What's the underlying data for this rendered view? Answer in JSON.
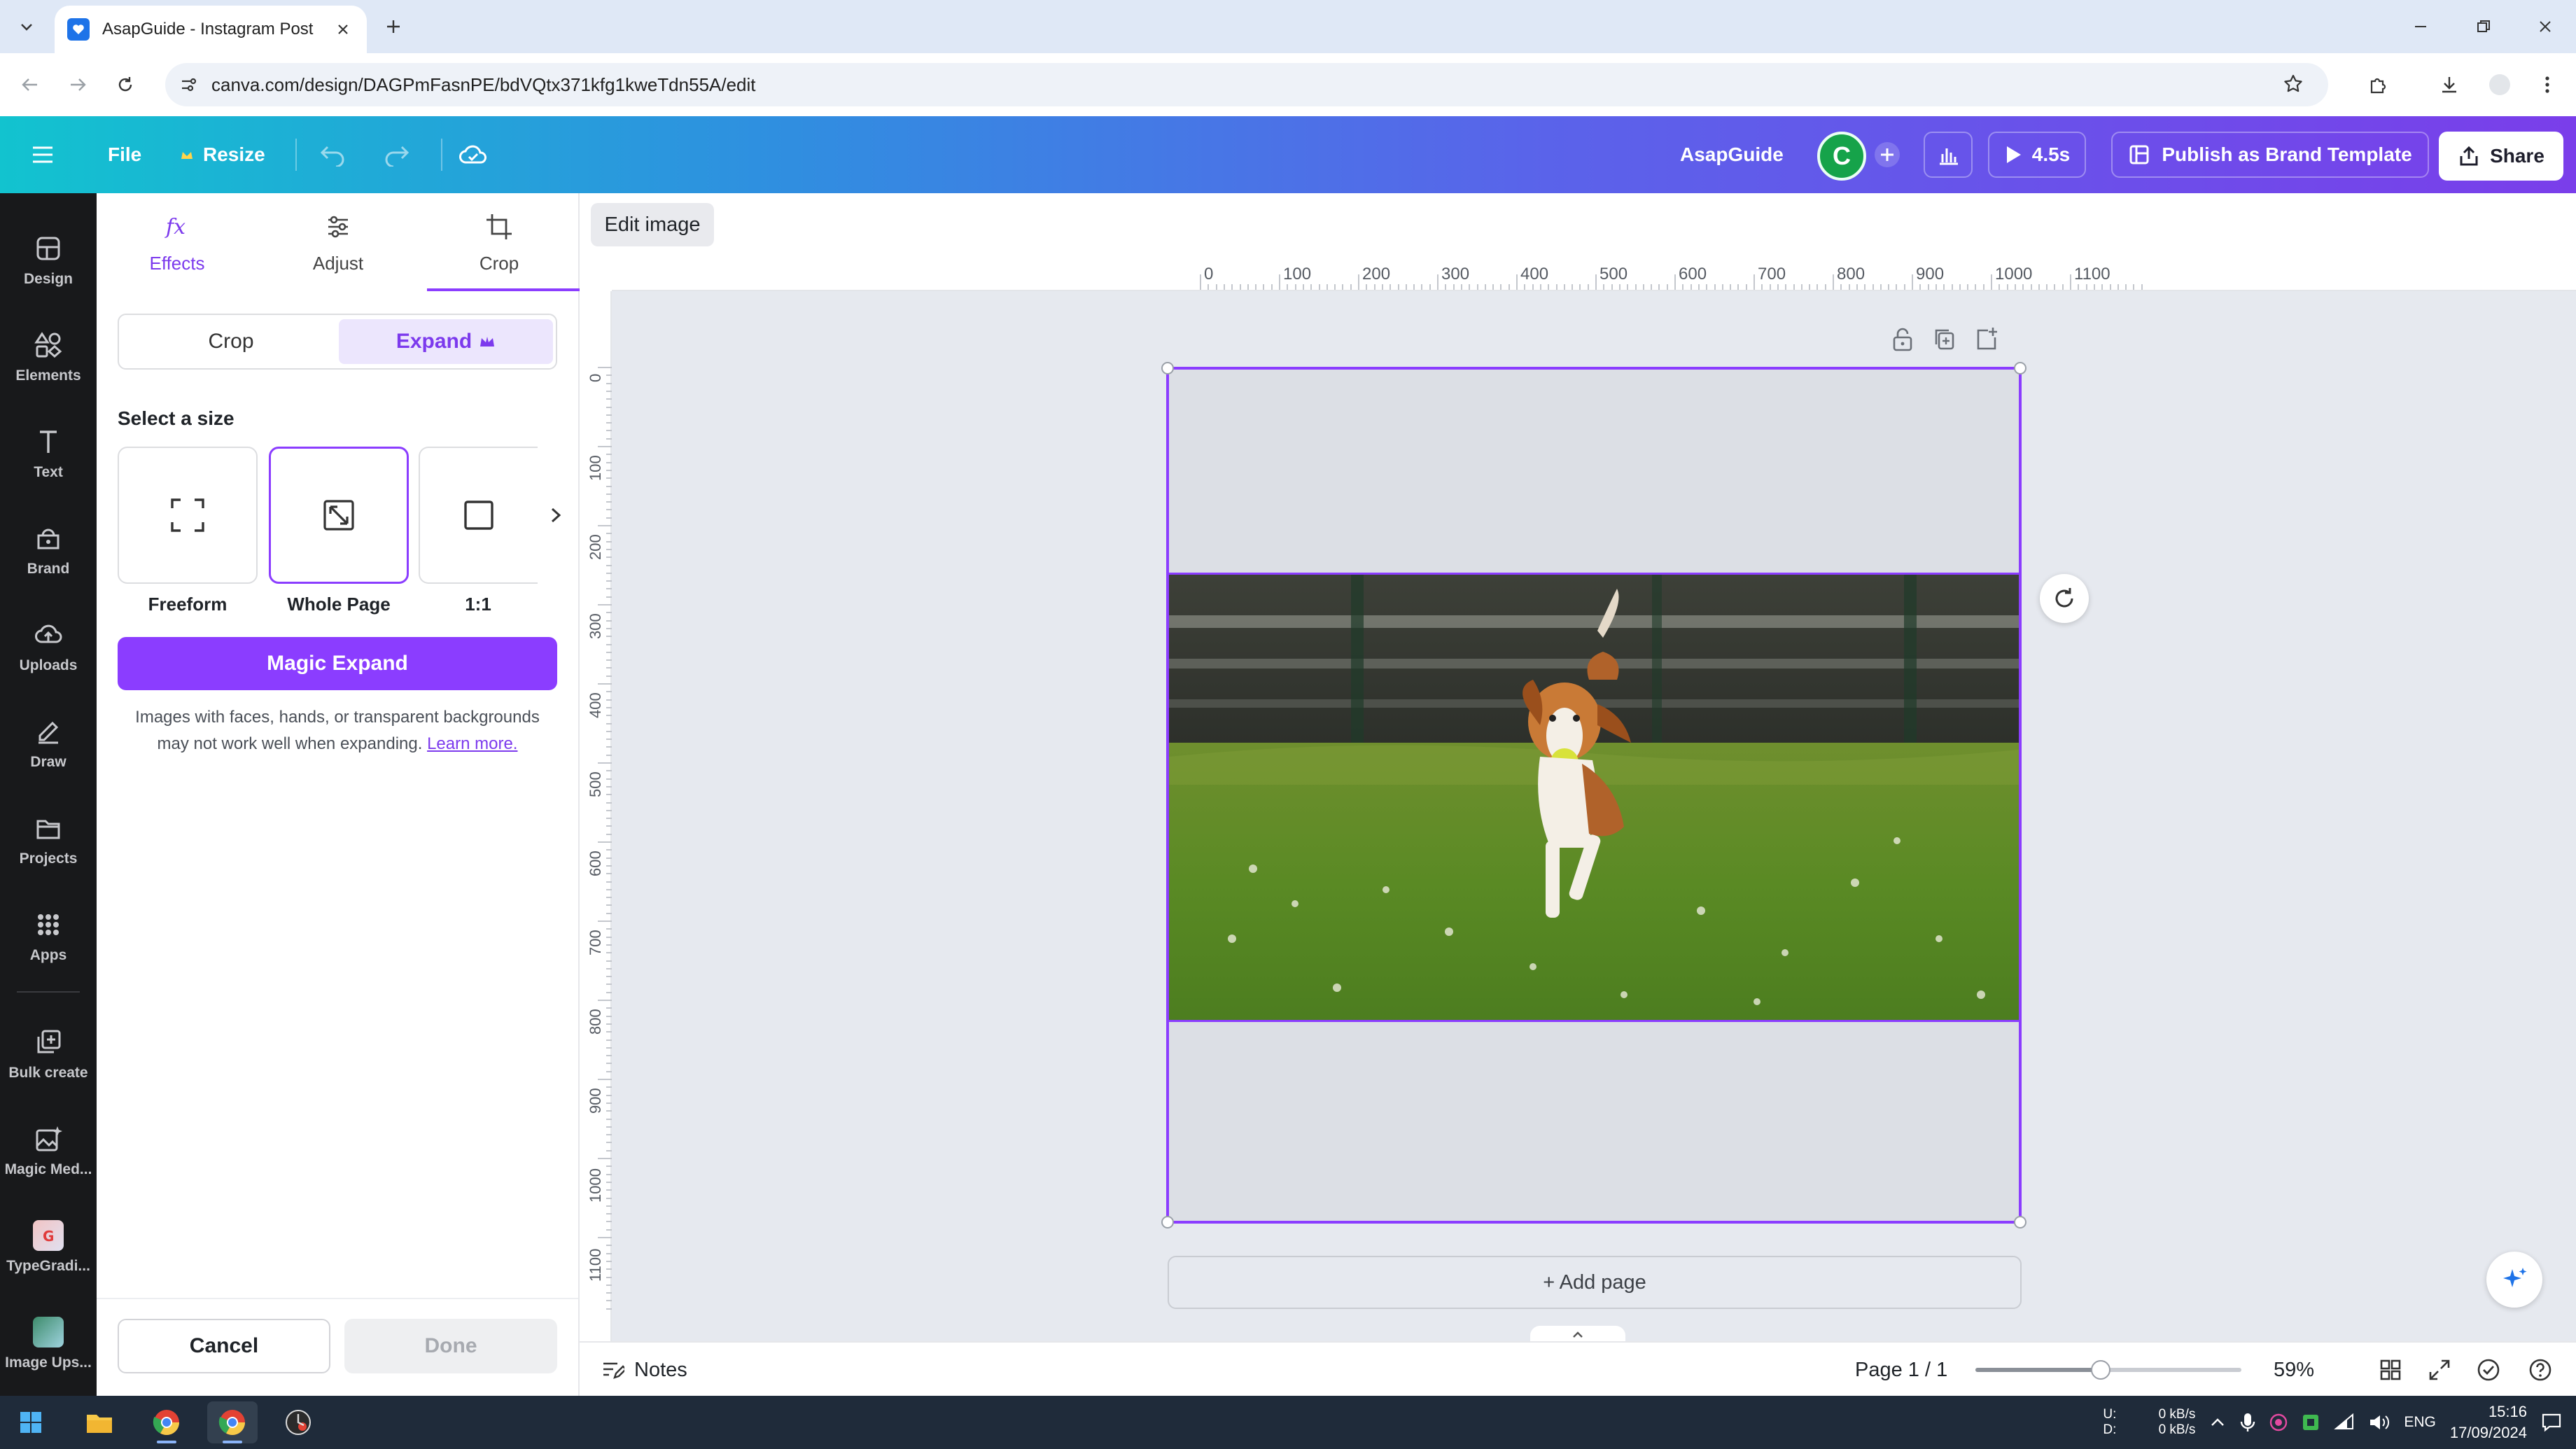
{
  "browser": {
    "tab_title": "AsapGuide - Instagram Post",
    "url": "canva.com/design/DAGPmFasnPE/bdVQtx371kfg1kweTdn55A/edit"
  },
  "header": {
    "file_label": "File",
    "resize_label": "Resize",
    "team_name": "AsapGuide",
    "avatar_initial": "C",
    "play_duration": "4.5s",
    "publish_label": "Publish as Brand Template",
    "share_label": "Share"
  },
  "rail": {
    "items": [
      {
        "label": "Design",
        "icon": "design-icon"
      },
      {
        "label": "Elements",
        "icon": "elements-icon"
      },
      {
        "label": "Text",
        "icon": "text-icon"
      },
      {
        "label": "Brand",
        "icon": "brand-icon"
      },
      {
        "label": "Uploads",
        "icon": "uploads-icon"
      },
      {
        "label": "Draw",
        "icon": "draw-icon"
      },
      {
        "label": "Projects",
        "icon": "projects-icon"
      },
      {
        "label": "Apps",
        "icon": "apps-icon"
      },
      {
        "label": "Bulk create",
        "icon": "bulk-create-icon"
      },
      {
        "label": "Magic Med...",
        "icon": "magic-media-icon"
      },
      {
        "label": "TypeGradi...",
        "icon": "typegradient-app"
      },
      {
        "label": "Image Ups...",
        "icon": "image-upscaler-app"
      }
    ]
  },
  "panel": {
    "tabs": [
      {
        "label": "Effects",
        "icon": "effects-icon"
      },
      {
        "label": "Adjust",
        "icon": "adjust-icon"
      },
      {
        "label": "Crop",
        "icon": "crop-icon"
      }
    ],
    "active_tab": "Crop",
    "mode_crop": "Crop",
    "mode_expand": "Expand",
    "select_size_label": "Select a size",
    "sizes": [
      {
        "label": "Freeform",
        "icon": "freeform-icon"
      },
      {
        "label": "Whole Page",
        "icon": "whole-page-icon",
        "selected": true
      },
      {
        "label": "1:1",
        "icon": "square-icon"
      }
    ],
    "magic_expand_label": "Magic Expand",
    "note_text": "Images with faces, hands, or transparent backgrounds may not work well when expanding.",
    "learn_more": "Learn more.",
    "cancel_label": "Cancel",
    "done_label": "Done"
  },
  "editor": {
    "edit_image_label": "Edit image",
    "ruler_h": [
      "0",
      "100",
      "200",
      "300",
      "400",
      "500",
      "600",
      "700",
      "800",
      "900",
      "1000",
      "1100"
    ],
    "ruler_v": [
      "0",
      "100",
      "200",
      "300",
      "400",
      "500",
      "600",
      "700",
      "800",
      "900",
      "1000",
      "1100"
    ],
    "add_page_label": "+ Add page"
  },
  "bottom": {
    "notes_label": "Notes",
    "page_indicator": "Page 1 / 1",
    "zoom": "59%",
    "zoom_level": 0.47
  },
  "taskbar": {
    "net_up_label": "U:",
    "net_down_label": "D:",
    "net_up": "0 kB/s",
    "net_down": "0 kB/s",
    "lang": "ENG",
    "time": "15:16",
    "date": "17/09/2024"
  },
  "colors": {
    "accent": "#8b3dff",
    "rail_bg": "#18191b"
  }
}
